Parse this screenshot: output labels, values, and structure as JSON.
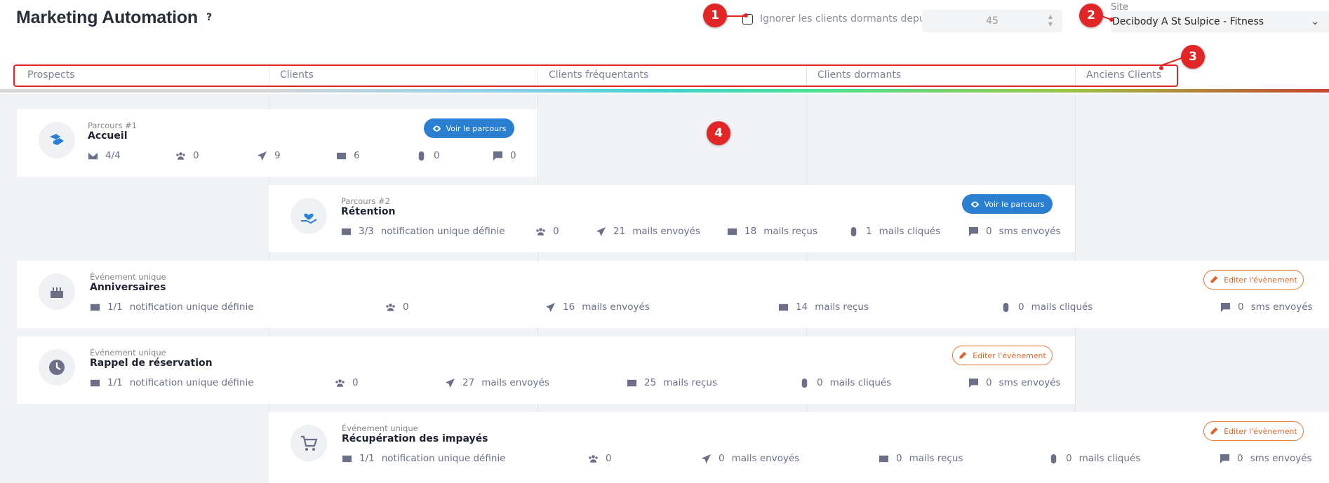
{
  "header": {
    "title": "Marketing Automation",
    "help": "?",
    "ignore_label": "Ignorer les clients dormants depuis",
    "ignore_days": "45",
    "site_label": "Site",
    "site_value": "Decibody A St Sulpice - Fitness"
  },
  "stages": [
    "Prospects",
    "Clients",
    "Clients fréquentants",
    "Clients dormants",
    "Anciens Clients"
  ],
  "cards": [
    {
      "category": "Parcours #1",
      "name": "Accueil",
      "icon": "handshake-icon",
      "button": "Voir le parcours",
      "stats": {
        "notifications": "4/4",
        "contacts": "0",
        "sent": "9",
        "received": "6",
        "clicked": "0",
        "sms": "0"
      }
    },
    {
      "category": "Parcours #2",
      "name": "Rétention",
      "icon": "heart-hand-icon",
      "button": "Voir le parcours",
      "stats": {
        "notifications": "3/3",
        "notifications_label": "notification unique définie",
        "contacts": "0",
        "sent": "21",
        "sent_label": "mails envoyés",
        "received": "18",
        "received_label": "mails reçus",
        "clicked": "1",
        "clicked_label": "mails cliqués",
        "sms": "0",
        "sms_label": "sms envoyés"
      }
    },
    {
      "category": "Événement unique",
      "name": "Anniversaires",
      "icon": "birthday-cake-icon",
      "button": "Editer l'évènement",
      "stats": {
        "notifications": "1/1",
        "notifications_label": "notification unique définie",
        "contacts": "0",
        "sent": "16",
        "sent_label": "mails envoyés",
        "received": "14",
        "received_label": "mails reçus",
        "clicked": "0",
        "clicked_label": "mails cliqués",
        "sms": "0",
        "sms_label": "sms envoyés"
      }
    },
    {
      "category": "Événement unique",
      "name": "Rappel de réservation",
      "icon": "clock-icon",
      "button": "Editer l'évènement",
      "stats": {
        "notifications": "1/1",
        "notifications_label": "notification unique définie",
        "contacts": "0",
        "sent": "27",
        "sent_label": "mails envoyés",
        "received": "25",
        "received_label": "mails reçus",
        "clicked": "0",
        "clicked_label": "mails cliqués",
        "sms": "0",
        "sms_label": "sms envoyés"
      }
    },
    {
      "category": "Événement unique",
      "name": "Récupération des impayés",
      "icon": "cart-icon",
      "button": "Editer l'évènement",
      "stats": {
        "notifications": "1/1",
        "notifications_label": "notification unique définie",
        "contacts": "0",
        "sent": "0",
        "sent_label": "mails envoyés",
        "received": "0",
        "received_label": "mails reçus",
        "clicked": "0",
        "clicked_label": "mails cliqués",
        "sms": "0",
        "sms_label": "sms envoyés"
      }
    }
  ],
  "annotations": [
    "1",
    "2",
    "3",
    "4"
  ],
  "colors": {
    "accent_blue": "#2b7fd0",
    "accent_orange": "#e0793a",
    "marker_red": "#e02626"
  }
}
